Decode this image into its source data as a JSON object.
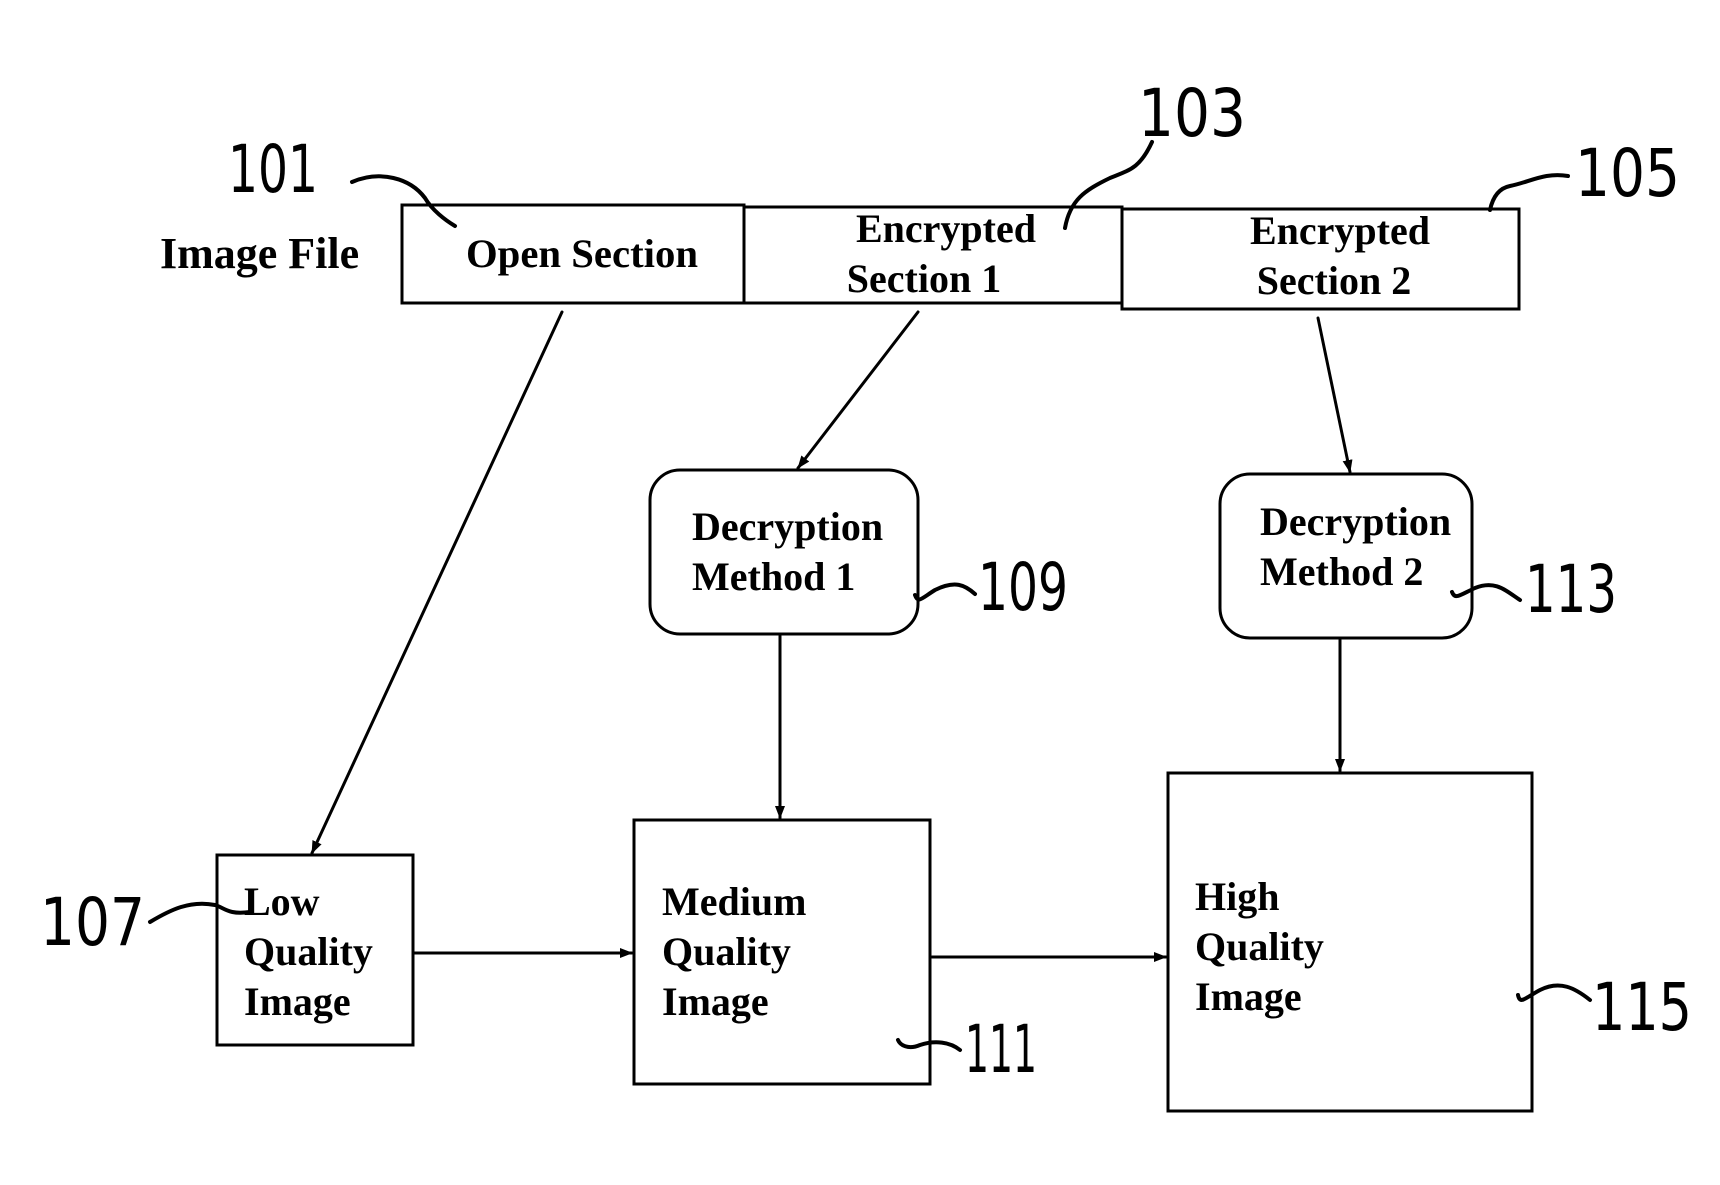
{
  "diagram": {
    "type": "block-flow",
    "file_label": "Image File",
    "file_sections": [
      {
        "id": "open",
        "lines": [
          "Open Section"
        ],
        "ref": "101"
      },
      {
        "id": "enc1",
        "lines": [
          "Encrypted",
          "Section 1"
        ],
        "ref": "103"
      },
      {
        "id": "enc2",
        "lines": [
          "Encrypted",
          "Section 2"
        ],
        "ref": "105"
      }
    ],
    "decryption": [
      {
        "id": "dec1",
        "lines": [
          "Decryption",
          "Method 1"
        ],
        "ref": "109"
      },
      {
        "id": "dec2",
        "lines": [
          "Decryption",
          "Method 2"
        ],
        "ref": "113"
      }
    ],
    "outputs": [
      {
        "id": "low",
        "lines": [
          "Low",
          "Quality",
          "Image"
        ],
        "ref": "107"
      },
      {
        "id": "medium",
        "lines": [
          "Medium",
          "Quality",
          "Image"
        ],
        "ref": "111"
      },
      {
        "id": "high",
        "lines": [
          "High",
          "Quality",
          "Image"
        ],
        "ref": "115"
      }
    ],
    "edges": [
      {
        "from": "open",
        "to": "low"
      },
      {
        "from": "enc1",
        "to": "dec1"
      },
      {
        "from": "enc2",
        "to": "dec2"
      },
      {
        "from": "dec1",
        "to": "medium"
      },
      {
        "from": "dec2",
        "to": "high"
      },
      {
        "from": "low",
        "to": "medium"
      },
      {
        "from": "medium",
        "to": "high"
      }
    ]
  }
}
